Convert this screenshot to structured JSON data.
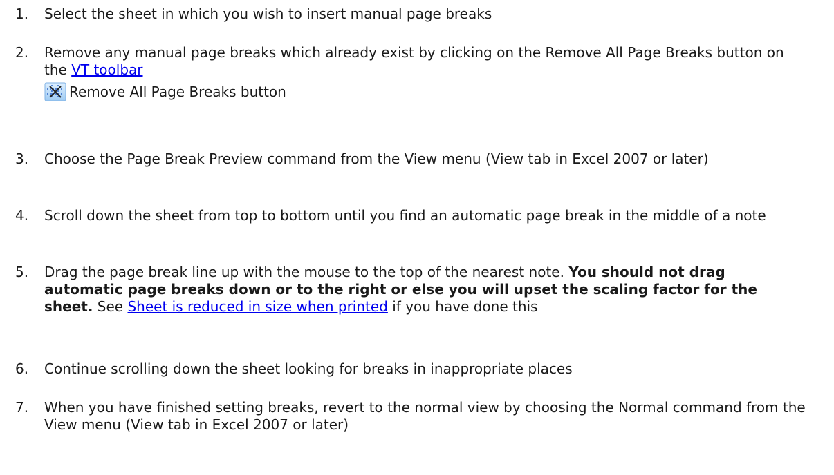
{
  "steps": [
    {
      "num": "1.",
      "text": "Select the sheet in which you wish to insert manual page breaks"
    },
    {
      "num": "2.",
      "text_before": "Remove any manual page breaks which already exist by clicking on the Remove All Page Breaks button on the ",
      "link": "VT toolbar",
      "button_icon": "remove-all-page-breaks-icon",
      "button_label": "Remove All Page Breaks button"
    },
    {
      "num": "3.",
      "text": "Choose the Page Break Preview command from the View menu (View tab in Excel 2007 or later)"
    },
    {
      "num": "4.",
      "text": "Scroll down the sheet from top to bottom until you find an automatic page break in the middle of a note"
    },
    {
      "num": "5.",
      "text_before": "Drag the page break line up with the mouse to the top of the nearest note. ",
      "bold": "You should not drag automatic page breaks down or to the right or else you will upset the scaling factor for the sheet.",
      "text_mid": " See ",
      "link": "Sheet is reduced in size when printed",
      "text_after": " if you have done this"
    },
    {
      "num": "6.",
      "text": "Continue scrolling down the sheet looking for breaks in inappropriate places"
    },
    {
      "num": "7.",
      "text": "When you have finished setting breaks, revert to the normal view by choosing the Normal command from the View menu (View tab in Excel 2007 or later)"
    }
  ],
  "colors": {
    "link": "#0000ee",
    "text": "#1a1a1a"
  }
}
